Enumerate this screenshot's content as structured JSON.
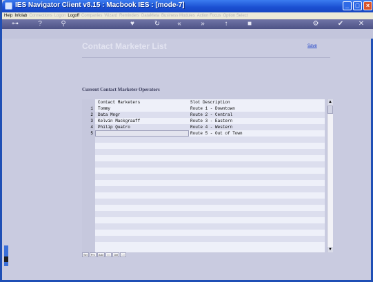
{
  "window": {
    "title": "IES Navigator Client v8.15 : Macbook IES :     [mode-7]"
  },
  "menu": {
    "items": [
      {
        "label": "Help",
        "enabled": true
      },
      {
        "label": "Infolab",
        "enabled": true
      },
      {
        "label": "Connections",
        "enabled": false
      },
      {
        "label": "Logon",
        "enabled": false
      },
      {
        "label": "Logoff",
        "enabled": true
      },
      {
        "label": "Companies",
        "enabled": false
      },
      {
        "label": "Wizard",
        "enabled": false
      },
      {
        "label": "Reminders",
        "enabled": false
      },
      {
        "label": "DataMeta",
        "enabled": false
      },
      {
        "label": "Business Modules",
        "enabled": false
      },
      {
        "label": "Action Focus",
        "enabled": false
      },
      {
        "label": "Option Select",
        "enabled": false
      }
    ]
  },
  "page": {
    "title": "Contact Marketer List",
    "save_label": "Save",
    "section_title": "Current Contact Marketer Operators"
  },
  "grid": {
    "col_headers": [
      "Contact Marketers",
      "Slot Description"
    ],
    "rows": [
      {
        "num": "1",
        "marketer": "Tommy",
        "slot": "Route 1 - Downtown"
      },
      {
        "num": "2",
        "marketer": "Data Mngr",
        "slot": "Route 2 - Central"
      },
      {
        "num": "3",
        "marketer": "Kelvin Mackgraaff",
        "slot": "Route 3 - Eastern"
      },
      {
        "num": "4",
        "marketer": "Philip Quatro",
        "slot": "Route 4 - Western"
      },
      {
        "num": "5",
        "marketer": "",
        "slot": "Route 5 - Out of Town"
      }
    ]
  },
  "footer": {
    "buttons": [
      {
        "label": "Sel",
        "enabled": true
      },
      {
        "label": "Prv",
        "enabled": true
      },
      {
        "label": "Add",
        "enabled": true
      },
      {
        "label": "Ins",
        "enabled": false
      },
      {
        "label": "Del",
        "enabled": true
      },
      {
        "label": "Clr",
        "enabled": false
      }
    ]
  },
  "colors": {
    "accent": "#1a4fd1",
    "background": "#c9cbe0",
    "row_stripe": "#dcdeee"
  }
}
